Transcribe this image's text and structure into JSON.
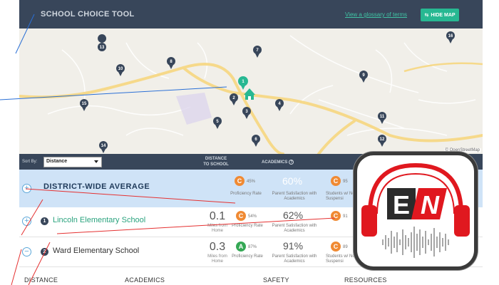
{
  "header": {
    "title": "SCHOOL CHOICE TOOL",
    "glossary_link": "View a glossary of terms",
    "hide_map_label": "HIDE MAP"
  },
  "map": {
    "markers": [
      "1",
      "2",
      "3",
      "4",
      "5",
      "6",
      "7",
      "8",
      "9",
      "10",
      "11",
      "12",
      "13",
      "14",
      "15",
      "16"
    ],
    "attribution": "© OpenStreetMap"
  },
  "table": {
    "sort_by_label": "Sort By:",
    "sort_value": "Distance",
    "col_distance": "DISTANCE TO SCHOOL",
    "col_academics": "ACADEMICS"
  },
  "average": {
    "title": "DISTRICT-WIDE AVERAGE",
    "grade": "C",
    "proficiency_pct": "45%",
    "proficiency_label": "Proficiency Rate",
    "satisfaction": "60%",
    "satisfaction_label": "Parent Satisfaction with Academics",
    "safety_grade": "C",
    "safety_pct": "95",
    "safety_label": "Students w/ No Suspensi"
  },
  "schools": [
    {
      "num": "1",
      "name": "Lincoln Elementary School",
      "distance": "0.1",
      "distance_label": "Miles from Home",
      "grade": "C",
      "proficiency_pct": "54%",
      "proficiency_label": "Proficiency Rate",
      "satisfaction": "62%",
      "satisfaction_label": "Parent Satisfaction with Academics",
      "safety_grade": "C",
      "safety_pct": "91"
    },
    {
      "num": "2",
      "name": "Ward Elementary School",
      "distance": "0.3",
      "distance_label": "Miles from Home",
      "grade": "A",
      "proficiency_pct": "87%",
      "proficiency_label": "Proficiency Rate",
      "satisfaction": "91%",
      "satisfaction_label": "Parent Satisfaction with Academics",
      "safety_grade": "C",
      "safety_pct": "89",
      "safety_label": "Students w/ No Suspensi"
    }
  ],
  "footer": {
    "distance": "DISTANCE",
    "academics": "ACADEMICS",
    "safety": "SAFETY",
    "resources": "RESOURCES"
  },
  "logo": {
    "letters": "EN",
    "colors": {
      "red": "#e0181f",
      "dark": "#2b2b2b"
    }
  },
  "colors": {
    "header_bg": "#38465a",
    "accent_green": "#27b892",
    "avg_row_bg": "#cfe3f7",
    "grade_c": "#f08a33",
    "grade_a": "#35a855"
  }
}
